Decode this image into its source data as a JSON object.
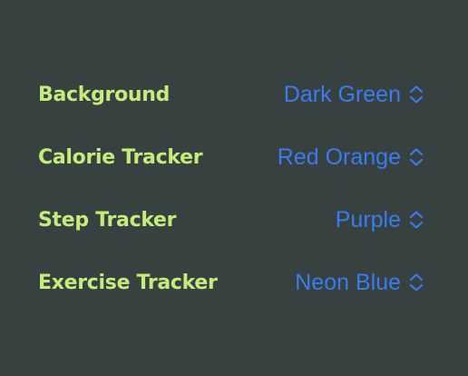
{
  "settings": {
    "rows": [
      {
        "label": "Background",
        "value": "Dark Green"
      },
      {
        "label": "Calorie Tracker",
        "value": "Red Orange"
      },
      {
        "label": "Step Tracker",
        "value": "Purple"
      },
      {
        "label": "Exercise Tracker",
        "value": "Neon Blue"
      }
    ]
  },
  "icons": {
    "picker_indicator": "chevron-up-down-icon"
  },
  "colors": {
    "background": "#374140",
    "label": "#c3ec7c",
    "accent": "#3a7bf0"
  }
}
